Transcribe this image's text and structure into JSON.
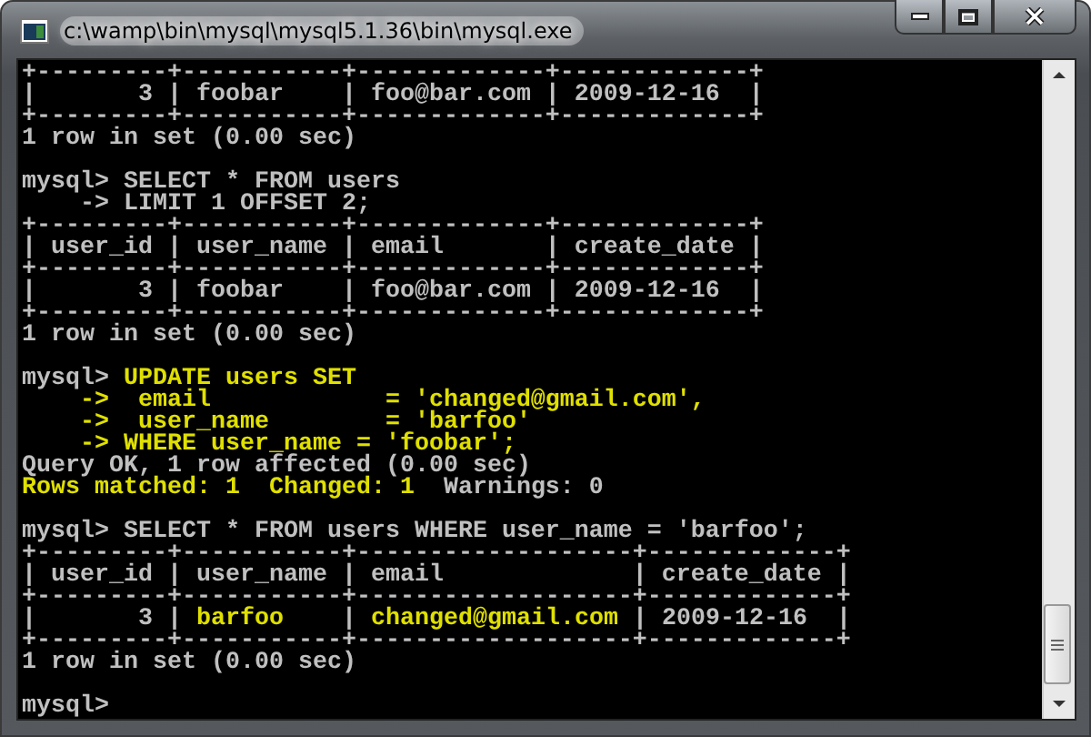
{
  "window": {
    "title": "c:\\wamp\\bin\\mysql\\mysql5.1.36\\bin\\mysql.exe",
    "buttons": [
      {
        "kind": "minimize"
      },
      {
        "kind": "maximize"
      },
      {
        "kind": "close"
      }
    ]
  },
  "console": {
    "lines": [
      {
        "kind": "text",
        "parts": [
          {
            "text": "+---------+-----------+-------------+-------------+",
            "color": "#c0c0c0"
          }
        ]
      },
      {
        "kind": "text",
        "parts": [
          {
            "text": "|       3 | foobar    | foo@bar.com | 2009-12-16  |",
            "color": "#c0c0c0"
          }
        ]
      },
      {
        "kind": "text",
        "parts": [
          {
            "text": "+---------+-----------+-------------+-------------+",
            "color": "#c0c0c0"
          }
        ]
      },
      {
        "kind": "text",
        "parts": [
          {
            "text": "1 row in set (0.00 sec)",
            "color": "#c0c0c0"
          }
        ]
      },
      {
        "kind": "blank"
      },
      {
        "kind": "text",
        "parts": [
          {
            "text": "mysql> SELECT * FROM users",
            "color": "#c0c0c0"
          }
        ]
      },
      {
        "kind": "text",
        "parts": [
          {
            "text": "    -> LIMIT 1 OFFSET 2;",
            "color": "#c0c0c0"
          }
        ]
      },
      {
        "kind": "text",
        "parts": [
          {
            "text": "+---------+-----------+-------------+-------------+",
            "color": "#c0c0c0"
          }
        ]
      },
      {
        "kind": "text",
        "parts": [
          {
            "text": "| user_id | user_name | email       | create_date |",
            "color": "#c0c0c0"
          }
        ]
      },
      {
        "kind": "text",
        "parts": [
          {
            "text": "+---------+-----------+-------------+-------------+",
            "color": "#c0c0c0"
          }
        ]
      },
      {
        "kind": "text",
        "parts": [
          {
            "text": "|       3 | foobar    | foo@bar.com | 2009-12-16  |",
            "color": "#c0c0c0"
          }
        ]
      },
      {
        "kind": "text",
        "parts": [
          {
            "text": "+---------+-----------+-------------+-------------+",
            "color": "#c0c0c0"
          }
        ]
      },
      {
        "kind": "text",
        "parts": [
          {
            "text": "1 row in set (0.00 sec)",
            "color": "#c0c0c0"
          }
        ]
      },
      {
        "kind": "blank"
      },
      {
        "kind": "text",
        "parts": [
          {
            "text": "mysql> ",
            "color": "#c0c0c0"
          },
          {
            "text": "UPDATE users SET",
            "color": "#e0e000"
          }
        ]
      },
      {
        "kind": "text",
        "parts": [
          {
            "text": "    ->  email            = 'changed@gmail.com',",
            "color": "#e0e000"
          }
        ]
      },
      {
        "kind": "text",
        "parts": [
          {
            "text": "    ->  user_name        = 'barfoo'",
            "color": "#e0e000"
          }
        ]
      },
      {
        "kind": "text",
        "parts": [
          {
            "text": "    -> WHERE user_name = 'foobar';",
            "color": "#e0e000"
          }
        ]
      },
      {
        "kind": "text",
        "parts": [
          {
            "text": "Query OK, 1 row affected (0.00 sec)",
            "color": "#c0c0c0"
          }
        ]
      },
      {
        "kind": "text",
        "parts": [
          {
            "text": "Rows matched: 1  Changed: 1",
            "color": "#e0e000"
          },
          {
            "text": "  Warnings: 0",
            "color": "#c0c0c0"
          }
        ]
      },
      {
        "kind": "blank"
      },
      {
        "kind": "text",
        "parts": [
          {
            "text": "mysql> SELECT * FROM users WHERE user_name = 'barfoo';",
            "color": "#c0c0c0"
          }
        ]
      },
      {
        "kind": "text",
        "parts": [
          {
            "text": "+---------+-----------+-------------------+-------------+",
            "color": "#c0c0c0"
          }
        ]
      },
      {
        "kind": "text",
        "parts": [
          {
            "text": "| user_id | user_name | email             | create_date |",
            "color": "#c0c0c0"
          }
        ]
      },
      {
        "kind": "text",
        "parts": [
          {
            "text": "+---------+-----------+-------------------+-------------+",
            "color": "#c0c0c0"
          }
        ]
      },
      {
        "kind": "text",
        "parts": [
          {
            "text": "|       3 | ",
            "color": "#c0c0c0"
          },
          {
            "text": "barfoo",
            "color": "#e0e000"
          },
          {
            "text": "    | ",
            "color": "#c0c0c0"
          },
          {
            "text": "changed@gmail.com",
            "color": "#e0e000"
          },
          {
            "text": " | 2009-12-16  |",
            "color": "#c0c0c0"
          }
        ]
      },
      {
        "kind": "text",
        "parts": [
          {
            "text": "+---------+-----------+-------------------+-------------+",
            "color": "#c0c0c0"
          }
        ]
      },
      {
        "kind": "text",
        "parts": [
          {
            "text": "1 row in set (0.00 sec)",
            "color": "#c0c0c0"
          }
        ]
      },
      {
        "kind": "blank"
      },
      {
        "kind": "text",
        "parts": [
          {
            "text": "mysql>",
            "color": "#c0c0c0"
          }
        ]
      }
    ]
  }
}
